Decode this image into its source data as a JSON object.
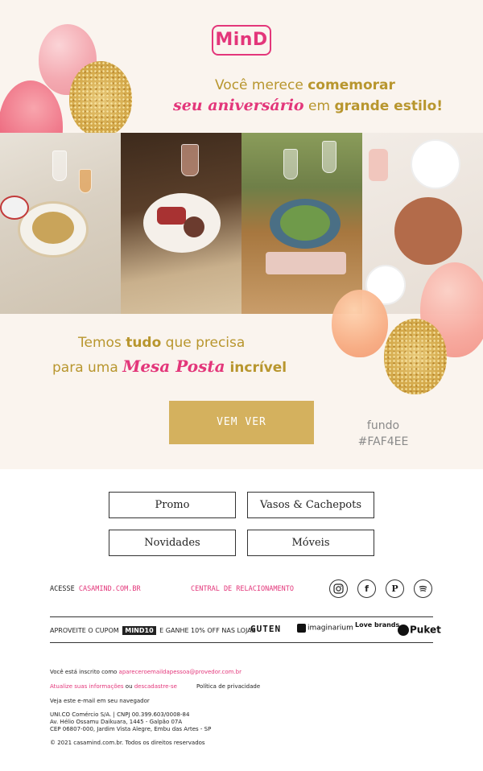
{
  "brand": {
    "logo": "MinD"
  },
  "hero": {
    "line1_normal": "Você merece ",
    "line1_bold": "comemorar",
    "line2_script": "seu aniversário",
    "line2_normal": " em ",
    "line2_bold": "grande estilo!",
    "sub1_a": "Temos ",
    "sub1_b": "tudo",
    "sub1_c": " que precisa",
    "sub2_a": "para uma ",
    "sub2_script": "Mesa Posta",
    "sub2_b": " incrível",
    "cta_label": "VEM VER",
    "bg_note_line1": "fundo",
    "bg_note_line2": "#FAF4EE"
  },
  "colors": {
    "background": "#FAF4EE",
    "accent_pink": "#E3367A",
    "accent_gold": "#D4B15E",
    "text_gold": "#B8962E"
  },
  "nav": {
    "promo": "Promo",
    "vasos": "Vasos & Cachepots",
    "novidades": "Novidades",
    "moveis": "Móveis"
  },
  "footer": {
    "acesse_label": "ACESSE ",
    "acesse_link": "CASAMIND.COM.BR",
    "central": "CENTRAL DE RELACIONAMENTO",
    "social_icons": [
      "instagram-icon",
      "facebook-icon",
      "pinterest-icon",
      "spotify-icon"
    ],
    "coupon_prefix": "APROVEITE O CUPOM ",
    "coupon_code": "MIND10",
    "coupon_suffix": " E GANHE 10% OFF NAS LOJAS",
    "brands": [
      "GUTEN",
      "imaginarium",
      "Love brands",
      "Puket"
    ],
    "subscribed_prefix": "Você está inscrito como ",
    "subscribed_email": "apareceroemaildapessoa@provedor.com.br",
    "update_info": "Atualize suas informações",
    "or": " ou ",
    "unsubscribe": "descadastre-se",
    "privacy": "Política de privacidade",
    "view_browser": "Veja este e-mail em seu navegador",
    "company_1": "UNI.CO Comércio S/A. | CNPJ 00.399.603/0008-84",
    "company_2": "Av. Hélio Ossamu Daikuara, 1445 - Galpão 07A",
    "company_3": "CEP 06807-000, Jardim Vista Alegre, Embu das Artes - SP",
    "copyright": "© 2021 casamind.com.br. Todos os direitos reservados"
  }
}
